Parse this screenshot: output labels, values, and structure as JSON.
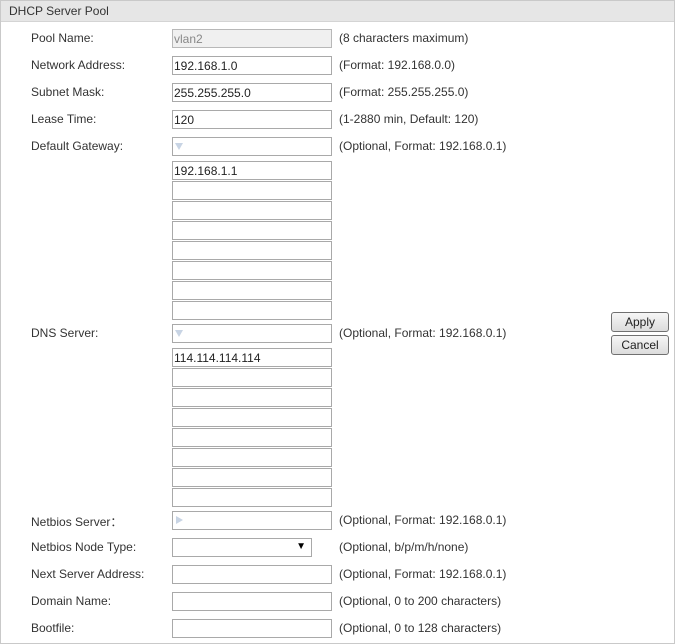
{
  "header": {
    "title": "DHCP Server Pool"
  },
  "pool_name": {
    "label": "Pool Name:",
    "value": "vlan2",
    "hint": "(8 characters maximum)"
  },
  "network_address": {
    "label": "Network Address:",
    "value": "192.168.1.0",
    "hint": "(Format: 192.168.0.0)"
  },
  "subnet_mask": {
    "label": "Subnet Mask:",
    "value": "255.255.255.0",
    "hint": "(Format: 255.255.255.0)"
  },
  "lease_time": {
    "label": "Lease Time:",
    "value": "120",
    "hint": "(1-2880 min, Default: 120)"
  },
  "default_gateway": {
    "label": "Default Gateway:",
    "hint": "(Optional, Format: 192.168.0.1)",
    "entries": [
      "192.168.1.1",
      "",
      "",
      "",
      "",
      "",
      "",
      ""
    ]
  },
  "dns_server": {
    "label": "DNS Server:",
    "hint": "(Optional, Format: 192.168.0.1)",
    "entries": [
      "114.114.114.114",
      "",
      "",
      "",
      "",
      "",
      "",
      ""
    ]
  },
  "netbios_server": {
    "label": "Netbios Server：",
    "hint": "(Optional, Format: 192.168.0.1)"
  },
  "netbios_node_type": {
    "label": "Netbios Node Type:",
    "value": "",
    "hint": "(Optional, b/p/m/h/none)"
  },
  "next_server": {
    "label": "Next Server Address:",
    "value": "",
    "hint": "(Optional, Format: 192.168.0.1)"
  },
  "domain_name": {
    "label": "Domain Name:",
    "value": "",
    "hint": "(Optional, 0 to 200 characters)"
  },
  "bootfile": {
    "label": "Bootfile:",
    "value": "",
    "hint": "(Optional, 0 to 128 characters)"
  },
  "buttons": {
    "apply": "Apply",
    "cancel": "Cancel"
  },
  "icons": {
    "dropdown_indicator": "triangle-down-icon",
    "expand_indicator": "triangle-right-icon",
    "select_arrow": "▼"
  }
}
